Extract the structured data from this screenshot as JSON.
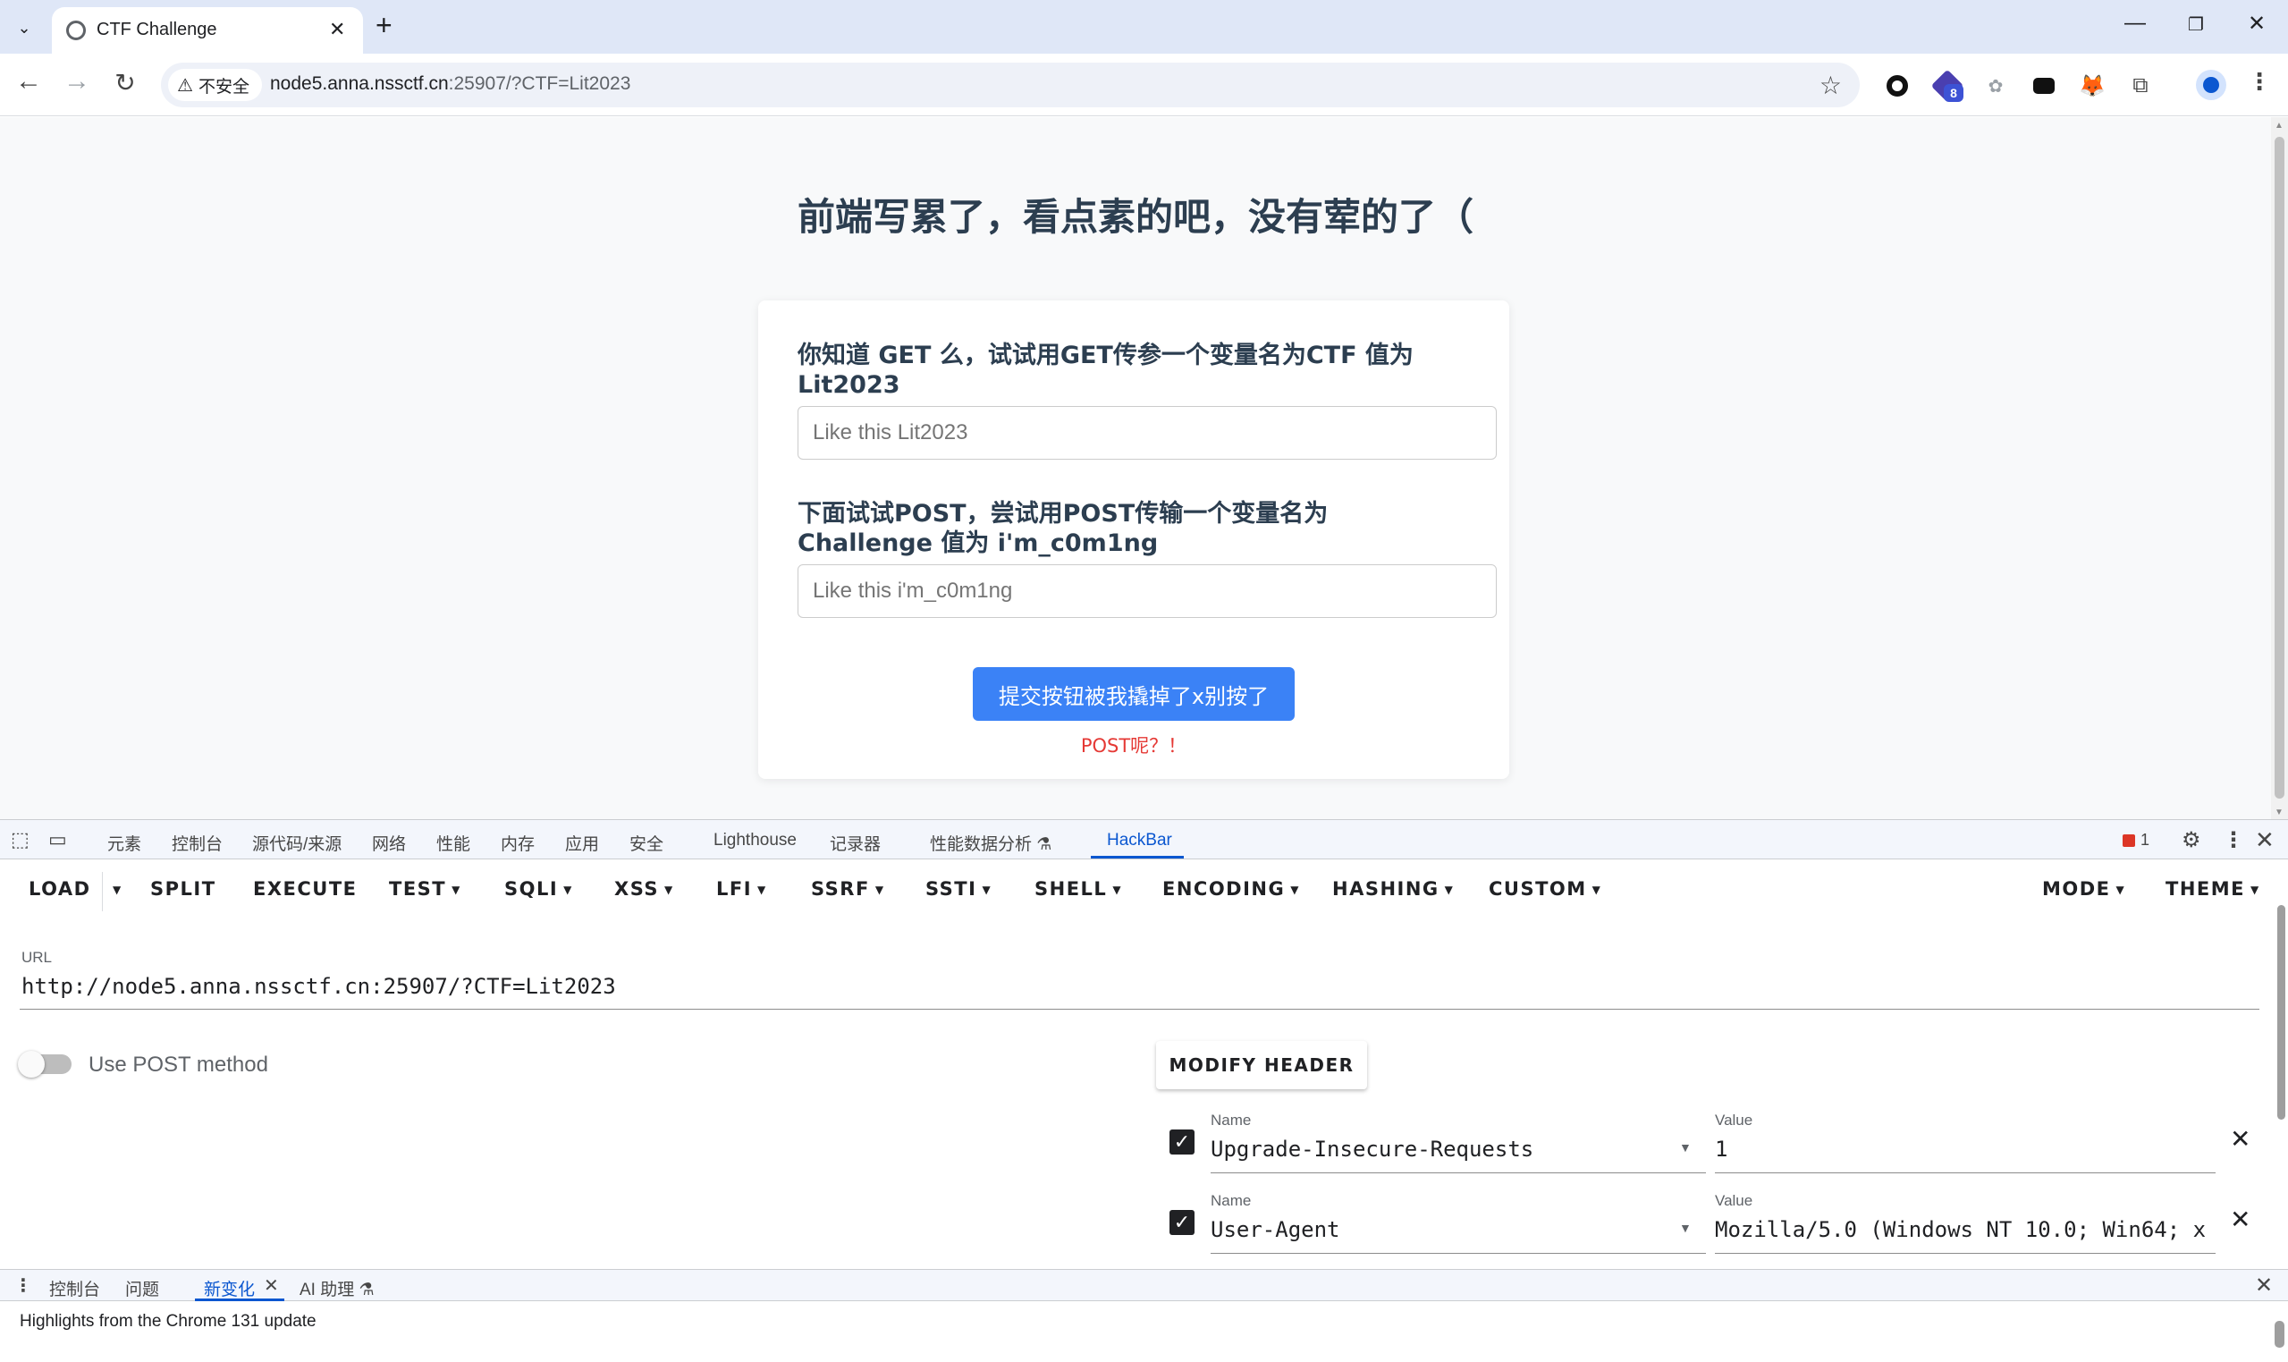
{
  "browser": {
    "tab_title": "CTF Challenge",
    "security_label": "不安全",
    "url_host": "node5.anna.nssctf.cn",
    "url_rest": ":25907/?CTF=Lit2023",
    "extension_badge": "8"
  },
  "page": {
    "heading": "前端写累了，看点素的吧，没有荤的了（",
    "q1_label": "你知道 GET 么，试试用GET传参一个变量名为CTF 值为 Lit2023",
    "q1_placeholder": "Like this Lit2023",
    "q2_label": "下面试试POST，尝试用POST传输一个变量名为Challenge 值为 i'm_c0m1ng",
    "q2_placeholder": "Like this i'm_c0m1ng",
    "submit_label": "提交按钮被我撬掉了x别按了",
    "hint": "POST呢？！"
  },
  "devtools": {
    "tabs": [
      "元素",
      "控制台",
      "源代码/来源",
      "网络",
      "性能",
      "内存",
      "应用",
      "安全",
      "Lighthouse",
      "记录器",
      "性能数据分析 ⚗",
      "HackBar"
    ],
    "error_count": "1"
  },
  "hackbar": {
    "buttons": [
      "LOAD",
      "SPLIT",
      "EXECUTE",
      "TEST",
      "SQLI",
      "XSS",
      "LFI",
      "SSRF",
      "SSTI",
      "SHELL",
      "ENCODING",
      "HASHING",
      "CUSTOM",
      "MODE",
      "THEME"
    ],
    "url_label": "URL",
    "url_value": "http://node5.anna.nssctf.cn:25907/?CTF=Lit2023",
    "post_label": "Use POST method",
    "post_enabled": false,
    "modify_header_label": "MODIFY HEADER",
    "headers": [
      {
        "name_label": "Name",
        "name": "Upgrade-Insecure-Requests",
        "value_label": "Value",
        "value": "1",
        "enabled": true
      },
      {
        "name_label": "Name",
        "name": "User-Agent",
        "value_label": "Value",
        "value": "Mozilla/5.0 (Windows NT 10.0; Win64; x",
        "enabled": true
      }
    ]
  },
  "drawer": {
    "tabs": [
      "控制台",
      "问题",
      "新变化",
      "AI 助理 ⚗"
    ],
    "content": "Highlights from the Chrome 131 update"
  }
}
